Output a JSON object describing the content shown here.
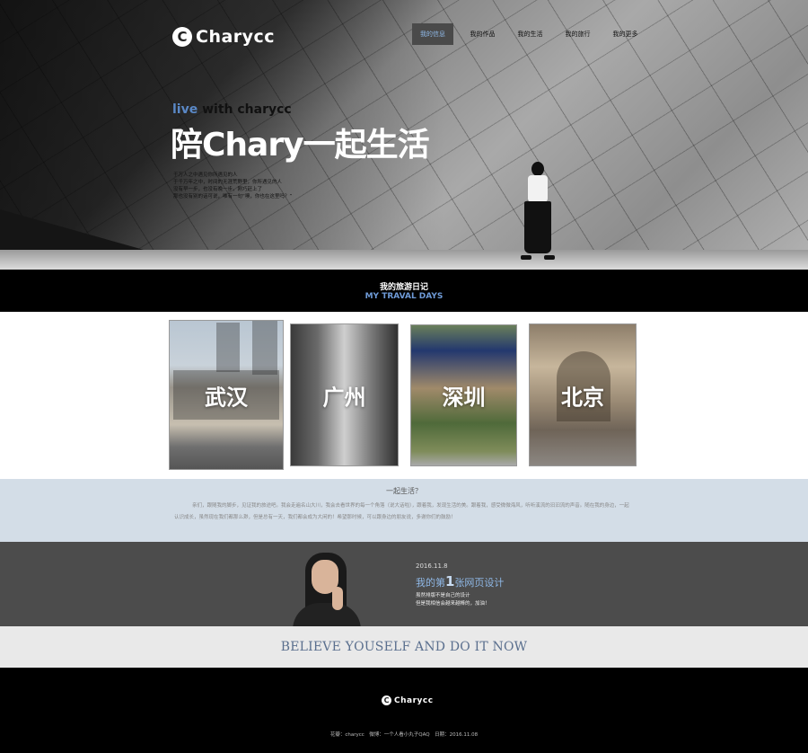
{
  "header": {
    "logo_mark": "C",
    "logo_text": "Charycc",
    "nav": [
      "我的信息",
      "我的作品",
      "我的生活",
      "我的旅行",
      "我的更多"
    ]
  },
  "hero": {
    "tagline_highlight": "live",
    "tagline_rest": " with charycc",
    "title": "陪Chary一起生活",
    "desc_lines": [
      "于万人之中遇见你所遇见的人",
      "于千万年之中，时间的无涯荒野里，你所遇见的人",
      "没有早一步，也没有晚一步，刚巧赶上了",
      "那也没有别的话可说，唯有一句“噢，你也在这里吗？”"
    ]
  },
  "diary": {
    "title_cn": "我的旅游日记",
    "title_en": "MY TRAVAL DAYS"
  },
  "cities": [
    "武汉",
    "广州",
    "深圳",
    "北京"
  ],
  "together": {
    "title": "一起生活？",
    "text": "亲们，跟随我的脚步，见证我的旅途吧。我会走遍名山大川，我会去看世界的每一个角落（说大话啦），跟着我，发现生活的美。跟着我，感受微微海风，听听溪流的汩汩流的声音。随在我的身边，一起认识成长，虽然现在我们都那么渺，但是总有一天，我们都会成为大闲的！希望那时候，可以跟身边的朋友说，多谢你们的鼓励！"
  },
  "first_page": {
    "date": "2016.11.8",
    "title_pre": "我的第",
    "title_num": "1",
    "title_post": "张网页设计",
    "lines": [
      "虽然排版不是自己的设计",
      "但是我相信会越来越棒的，加油！"
    ]
  },
  "believe": {
    "text": "BELIEVE YOUSELF AND DO IT NOW"
  },
  "footer": {
    "logo_mark": "C",
    "logo_text": "Charycc",
    "info": "花瓣：charycc　微博：一个人看小丸子QAQ　日期：2016.11.08"
  }
}
